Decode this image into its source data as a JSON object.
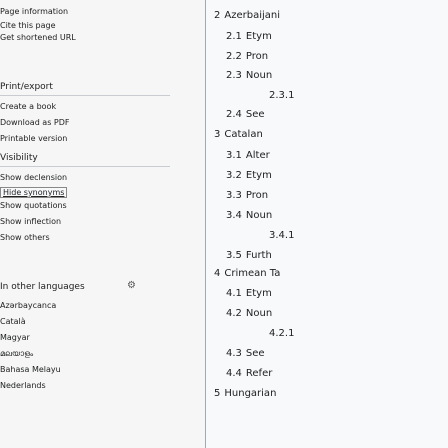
{
  "sidebar": {
    "info": [
      "Page information",
      "Cite this page",
      "Get shortened URL"
    ],
    "print_head": "Print/export",
    "print": [
      "Create a book",
      "Download as PDF",
      "Printable version"
    ],
    "visibility_head": "Visibility",
    "visibility": {
      "show_declension": "Show declension",
      "hide_synonyms": "Hide synonyms",
      "rest": [
        "Show quotations",
        "Show inflection",
        "Show others"
      ]
    },
    "languages_head": "In other languages",
    "languages": [
      "Azərbaycanca",
      "Català",
      "Magyar",
      "മലയാളം",
      "Bahasa Melayu",
      "Nederlands"
    ]
  },
  "toc": [
    {
      "num": "",
      "text": "",
      "level": 0
    },
    {
      "num": "2",
      "text": "Azerbaijani",
      "level": 1
    },
    {
      "num": "2.1",
      "text": "Etym",
      "level": 2
    },
    {
      "num": "2.2",
      "text": "Pron",
      "level": 2
    },
    {
      "num": "2.3",
      "text": "Noun",
      "level": 2
    },
    {
      "num": "2.3.1",
      "text": "",
      "level": 3
    },
    {
      "num": "2.4",
      "text": "See",
      "level": 2
    },
    {
      "num": "3",
      "text": "Catalan",
      "level": 1
    },
    {
      "num": "3.1",
      "text": "Alter",
      "level": 2
    },
    {
      "num": "3.2",
      "text": "Etym",
      "level": 2
    },
    {
      "num": "3.3",
      "text": "Pron",
      "level": 2
    },
    {
      "num": "3.4",
      "text": "Noun",
      "level": 2
    },
    {
      "num": "3.4.1",
      "text": "",
      "level": 3
    },
    {
      "num": "3.5",
      "text": "Furth",
      "level": 2
    },
    {
      "num": "4",
      "text": "Crimean Ta",
      "level": 1
    },
    {
      "num": "4.1",
      "text": "Etym",
      "level": 2
    },
    {
      "num": "4.2",
      "text": "Noun",
      "level": 2
    },
    {
      "num": "4.2.1",
      "text": "",
      "level": 3
    },
    {
      "num": "4.3",
      "text": "See",
      "level": 2
    },
    {
      "num": "4.4",
      "text": "Refer",
      "level": 2
    },
    {
      "num": "5",
      "text": "Hungarian",
      "level": 1
    }
  ]
}
